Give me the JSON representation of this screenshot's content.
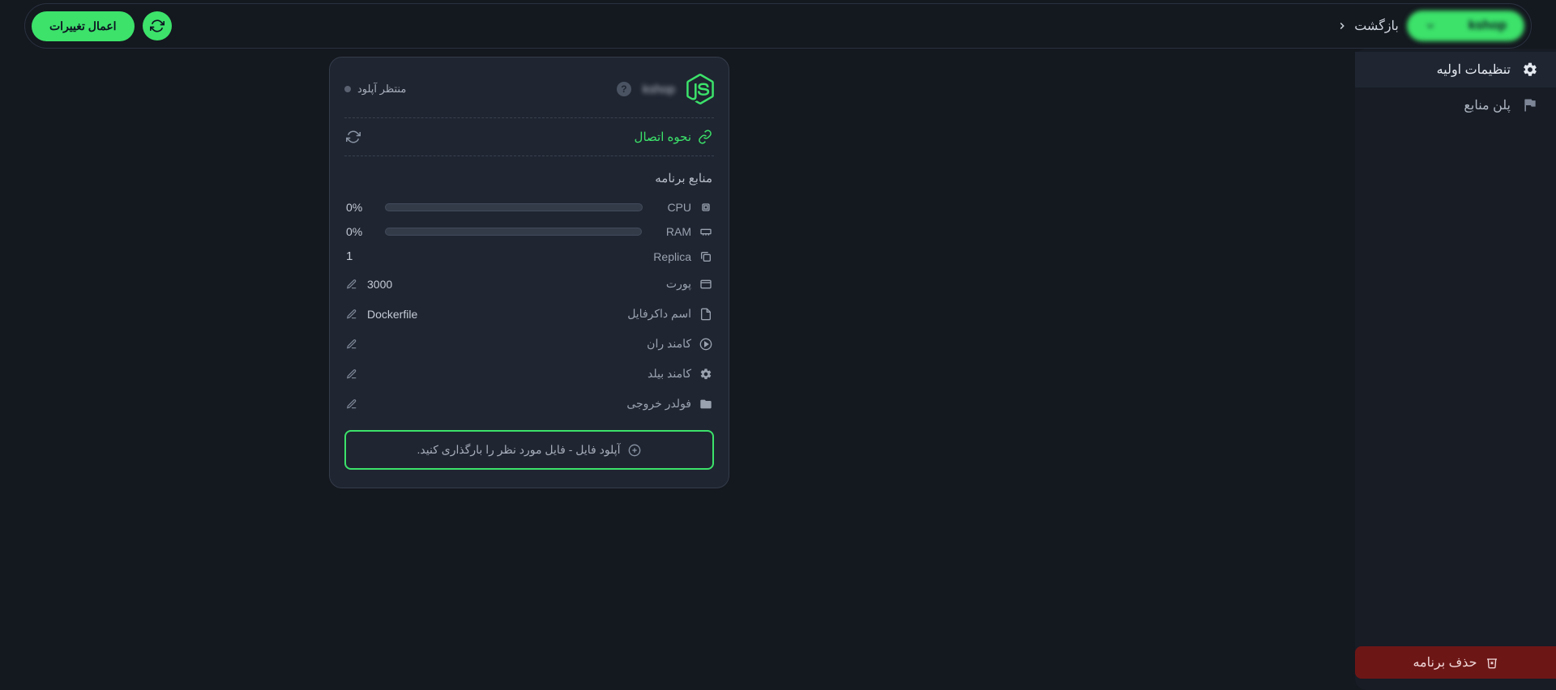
{
  "topbar": {
    "dropdown_label": "kshop",
    "back_label": "بازگشت",
    "apply_label": "اعمال تغییرات"
  },
  "sidebar": {
    "items": [
      {
        "label": "تنظیمات اولیه"
      },
      {
        "label": "پلن منابع"
      }
    ]
  },
  "delete_button": {
    "label": "حذف برنامه"
  },
  "card": {
    "app_name": "kshop",
    "status": "منتظر آپلود",
    "connection_label": "نحوه اتصال",
    "resources_title": "منابع برنامه",
    "resources": {
      "cpu": {
        "label": "CPU",
        "percent": "0%"
      },
      "ram": {
        "label": "RAM",
        "percent": "0%"
      },
      "replica": {
        "label": "Replica",
        "value": "1"
      }
    },
    "config": {
      "port": {
        "label": "پورت",
        "value": "3000"
      },
      "dockerfile": {
        "label": "اسم داکرفایل",
        "value": "Dockerfile"
      },
      "run_cmd": {
        "label": "کامند ران",
        "value": ""
      },
      "build_cmd": {
        "label": "کامند بیلد",
        "value": ""
      },
      "output_folder": {
        "label": "فولدر خروجی",
        "value": ""
      }
    },
    "upload": {
      "text": "آپلود فایل - فایل مورد نظر را بارگذاری کنید."
    }
  }
}
